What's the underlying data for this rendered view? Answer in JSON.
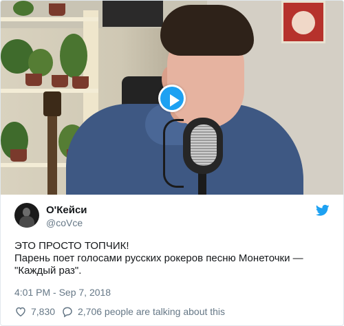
{
  "video": {
    "play_icon": "play-icon",
    "accent_color": "#1da1f2"
  },
  "author": {
    "display_name": "О'Кейси",
    "handle": "@coVce",
    "avatar_icon": "avatar-icon",
    "brand_icon": "twitter-bird-icon"
  },
  "tweet": {
    "lines": [
      "ЭТО ПРОСТО ТОПЧИК!",
      "Парень поет голосами русских рокеров песню Монеточки —",
      "\"Каждый раз\"."
    ],
    "timestamp": "4:01 PM - Sep 7, 2018"
  },
  "actions": {
    "likes_icon": "heart-icon",
    "likes_count": "7,830",
    "talking_icon": "speech-bubble-icon",
    "talking_text": "2,706 people are talking about this"
  },
  "colors": {
    "text_primary": "#14171a",
    "text_secondary": "#657786",
    "brand_blue": "#1da1f2"
  }
}
